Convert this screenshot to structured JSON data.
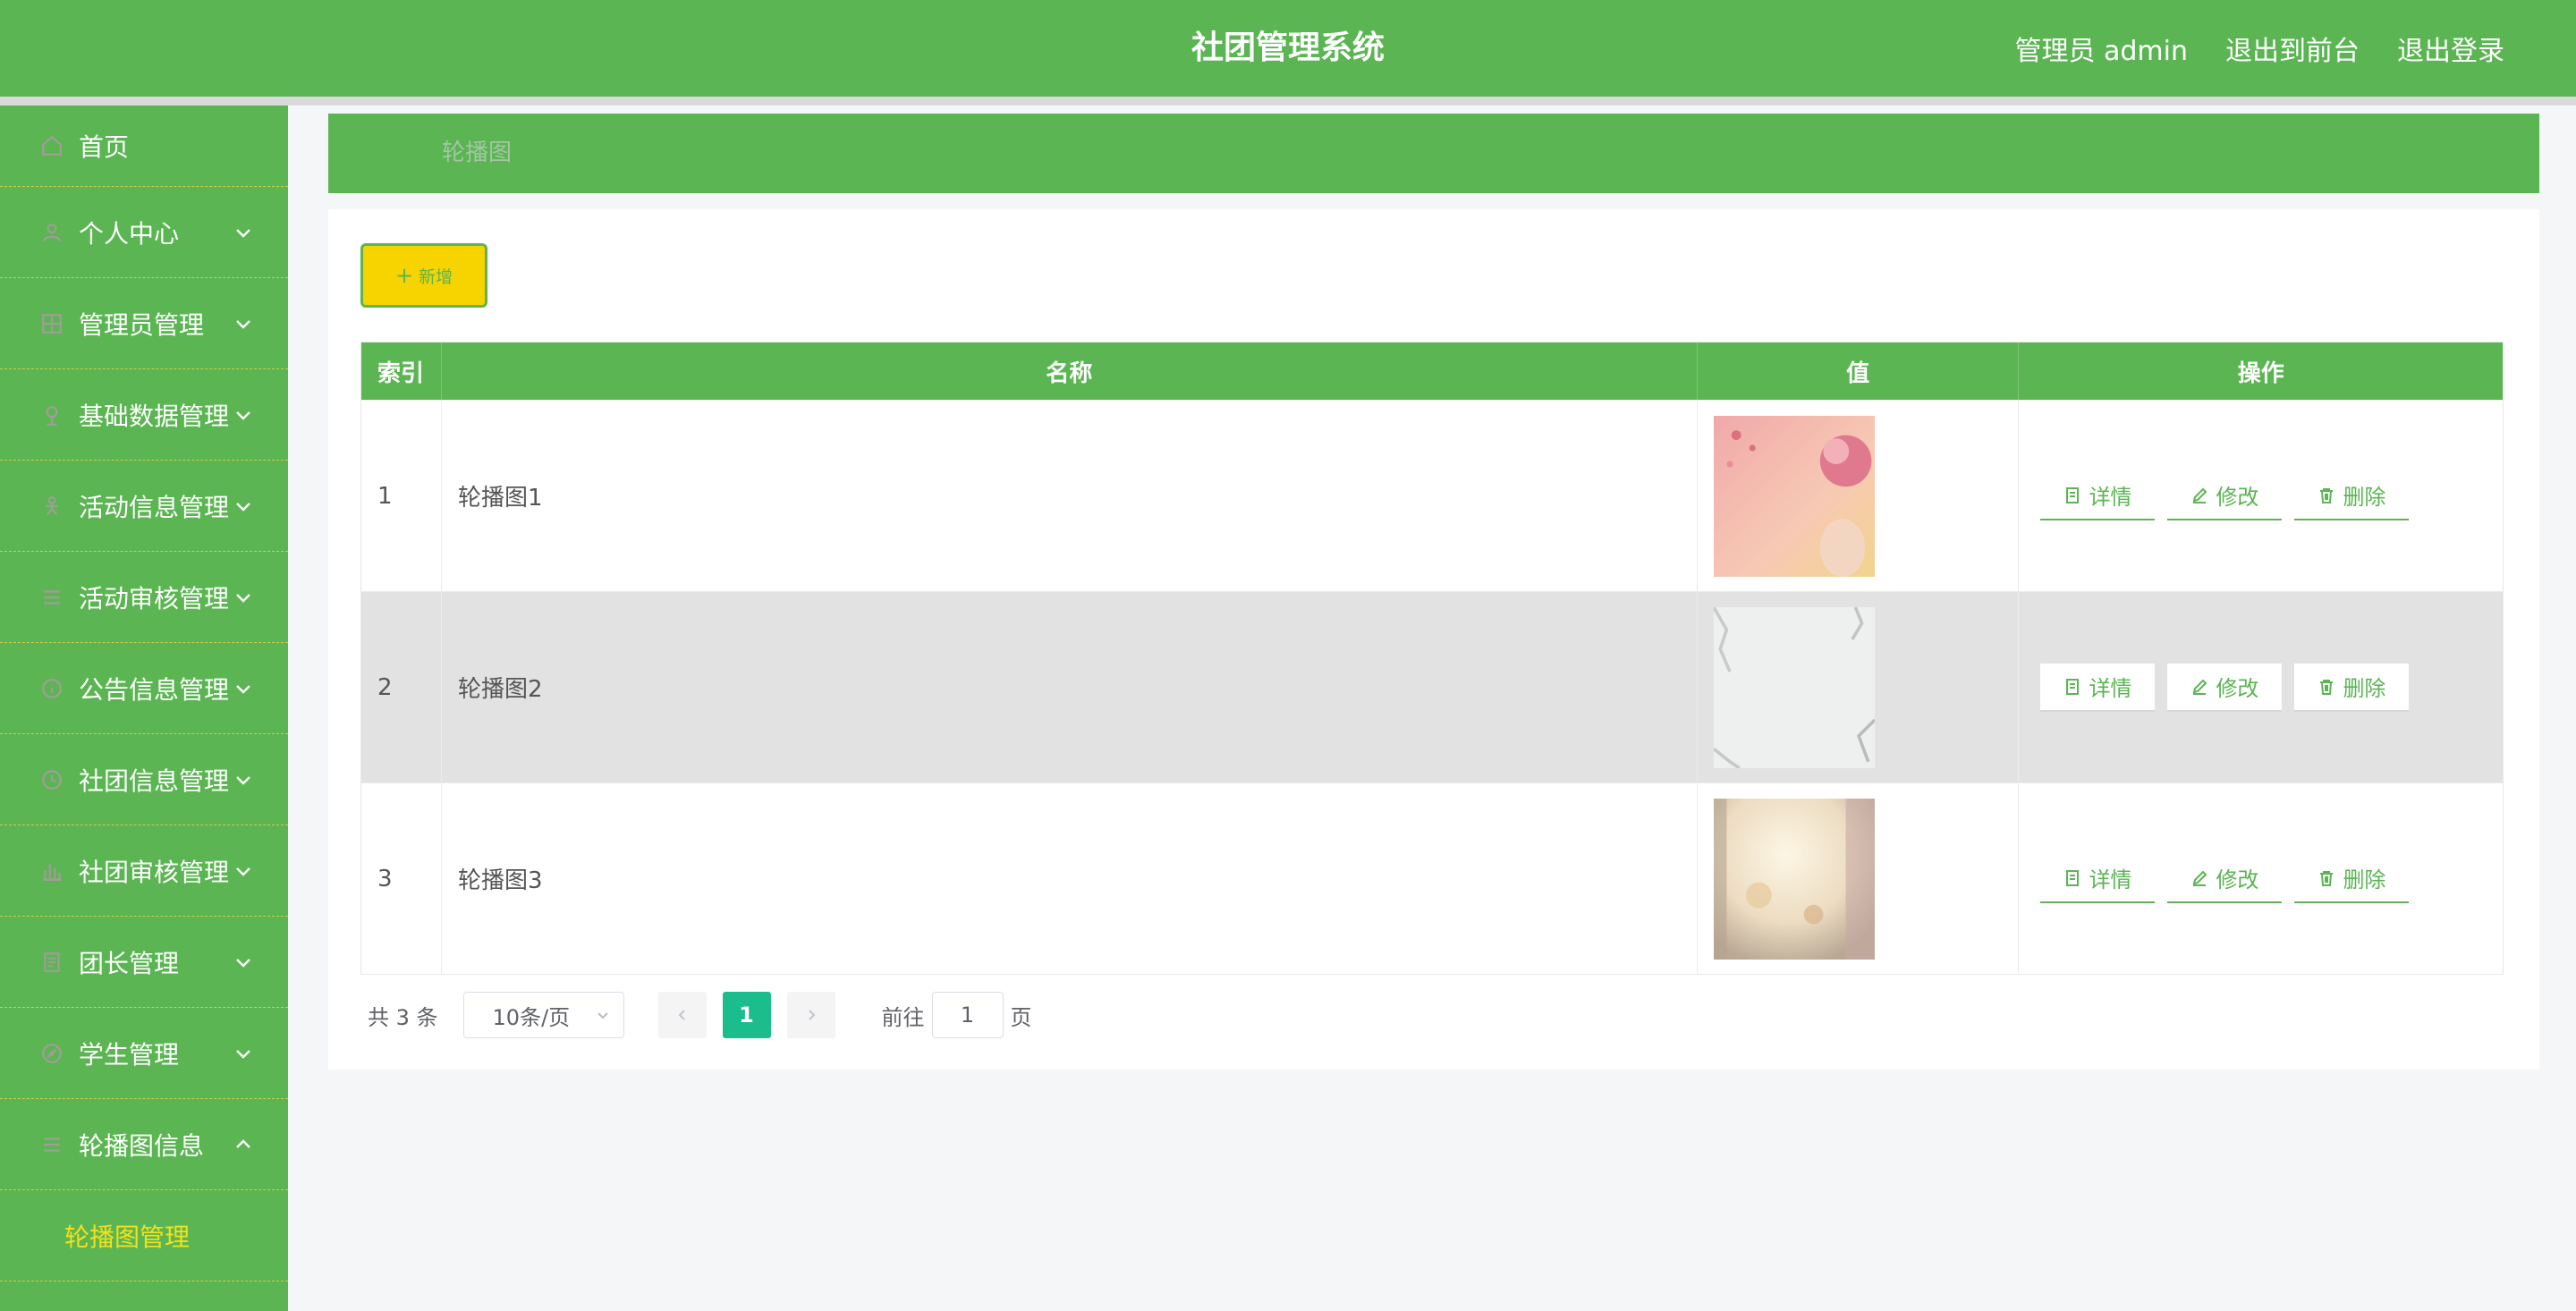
{
  "header": {
    "title": "社团管理系统",
    "admin": "管理员 admin",
    "exit_front": "退出到前台",
    "logout": "退出登录"
  },
  "sidebar": {
    "items": [
      {
        "label": "首页",
        "icon": "home-icon"
      },
      {
        "label": "个人中心",
        "icon": "user-icon"
      },
      {
        "label": "管理员管理",
        "icon": "grid-icon"
      },
      {
        "label": "基础数据管理",
        "icon": "pin-icon"
      },
      {
        "label": "活动信息管理",
        "icon": "person-icon"
      },
      {
        "label": "活动审核管理",
        "icon": "list-icon"
      },
      {
        "label": "公告信息管理",
        "icon": "info-icon"
      },
      {
        "label": "社团信息管理",
        "icon": "clock-icon"
      },
      {
        "label": "社团审核管理",
        "icon": "bar-chart-icon"
      },
      {
        "label": "团长管理",
        "icon": "document-icon"
      },
      {
        "label": "学生管理",
        "icon": "compass-icon"
      },
      {
        "label": "轮播图信息",
        "icon": "list-icon"
      }
    ],
    "submenu": {
      "label": "轮播图管理"
    }
  },
  "breadcrumb": {
    "current": "轮播图"
  },
  "toolbar": {
    "add_label": "新增"
  },
  "table": {
    "columns": [
      "索引",
      "名称",
      "值",
      "操作"
    ],
    "rows": [
      {
        "index": "1",
        "name": "轮播图1"
      },
      {
        "index": "2",
        "name": "轮播图2"
      },
      {
        "index": "3",
        "name": "轮播图3"
      }
    ],
    "actions": {
      "detail": "详情",
      "edit": "修改",
      "delete": "删除"
    }
  },
  "pagination": {
    "total": "共 3 条",
    "page_size": "10条/页",
    "current_page": "1",
    "goto_label": "前往",
    "goto_value": "1",
    "page_suffix": "页"
  },
  "colors": {
    "brand_green": "#5ab552",
    "active_page": "#1bbd8d",
    "add_button": "#f7d300",
    "submenu_active": "#f5e11a"
  }
}
